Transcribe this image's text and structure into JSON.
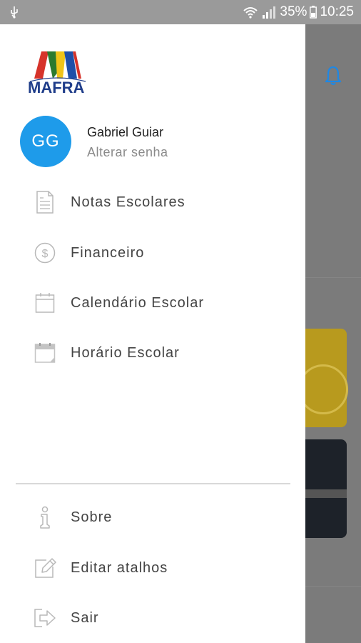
{
  "status_bar": {
    "battery_percent": "35%",
    "time": "10:25",
    "icons": [
      "usb-icon",
      "wifi-icon",
      "signal-icon",
      "battery-icon"
    ]
  },
  "app": {
    "brand_name": "MAFRA",
    "colors": {
      "avatar": "#1e9bea",
      "brand_blue": "#1f3d8a",
      "bell": "#1e88e5"
    }
  },
  "user": {
    "initials": "GG",
    "name": "Gabriel Guiar",
    "change_password": "Alterar senha"
  },
  "menu": [
    {
      "label": "Notas Escolares",
      "icon": "grades-document-icon"
    },
    {
      "label": "Financeiro",
      "icon": "dollar-circle-icon"
    },
    {
      "label": "Calendário Escolar",
      "icon": "calendar-icon"
    },
    {
      "label": "Horário Escolar",
      "icon": "schedule-calendar-icon"
    }
  ],
  "footer_menu": [
    {
      "label": "Sobre",
      "icon": "info-icon"
    },
    {
      "label": "Editar atalhos",
      "icon": "edit-icon"
    },
    {
      "label": "Sair",
      "icon": "logout-icon"
    }
  ]
}
